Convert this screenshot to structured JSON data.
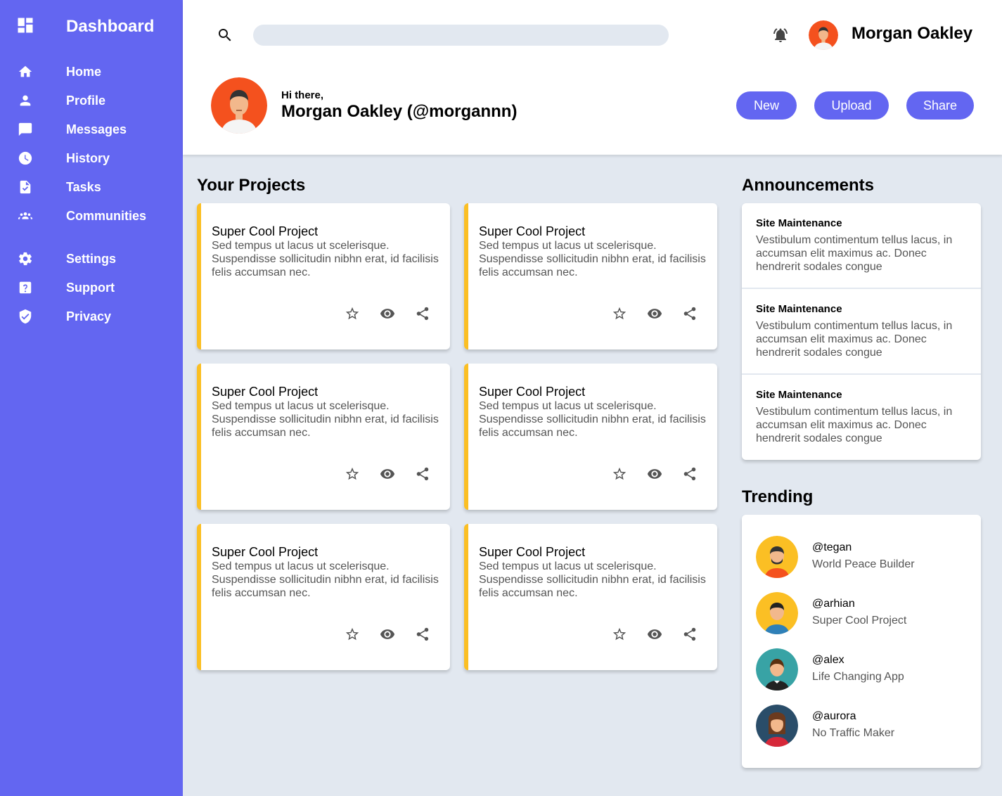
{
  "sidebar": {
    "brand": {
      "title": "Dashboard",
      "icon": "dashboard-icon"
    },
    "items": [
      {
        "label": "Home",
        "icon": "home-icon"
      },
      {
        "label": "Profile",
        "icon": "person-icon"
      },
      {
        "label": "Messages",
        "icon": "chat-icon"
      },
      {
        "label": "History",
        "icon": "clock-icon"
      },
      {
        "label": "Tasks",
        "icon": "task-icon"
      },
      {
        "label": "Communities",
        "icon": "group-icon"
      },
      {
        "label": "Settings",
        "icon": "gear-icon"
      },
      {
        "label": "Support",
        "icon": "help-icon"
      },
      {
        "label": "Privacy",
        "icon": "shield-icon"
      }
    ]
  },
  "header": {
    "search": {
      "placeholder": ""
    },
    "user_name": "Morgan Oakley",
    "greeting": "Hi there,",
    "full_name": "Morgan Oakley (@morgannn)",
    "buttons": {
      "new": "New",
      "upload": "Upload",
      "share": "Share"
    }
  },
  "projects": {
    "title": "Your Projects",
    "items": [
      {
        "title": "Super Cool Project",
        "description": "Sed tempus ut lacus ut scelerisque. Suspendisse sollicitudin nibhn erat, id facilisis felis accumsan nec."
      },
      {
        "title": "Super Cool Project",
        "description": "Sed tempus ut lacus ut scelerisque. Suspendisse sollicitudin nibhn erat, id facilisis felis accumsan nec."
      },
      {
        "title": "Super Cool Project",
        "description": "Sed tempus ut lacus ut scelerisque. Suspendisse sollicitudin nibhn erat, id facilisis felis accumsan nec."
      },
      {
        "title": "Super Cool Project",
        "description": "Sed tempus ut lacus ut scelerisque. Suspendisse sollicitudin nibhn erat, id facilisis felis accumsan nec."
      },
      {
        "title": "Super Cool Project",
        "description": "Sed tempus ut lacus ut scelerisque. Suspendisse sollicitudin nibhn erat, id facilisis felis accumsan nec."
      },
      {
        "title": "Super Cool Project",
        "description": "Sed tempus ut lacus ut scelerisque. Suspendisse sollicitudin nibhn erat, id facilisis felis accumsan nec."
      }
    ]
  },
  "announcements": {
    "title": "Announcements",
    "items": [
      {
        "title": "Site Maintenance",
        "body": "Vestibulum contimentum tellus lacus, in accumsan elit maximus ac. Donec hendrerit sodales congue"
      },
      {
        "title": "Site Maintenance",
        "body": "Vestibulum contimentum tellus lacus, in accumsan elit maximus ac. Donec hendrerit sodales congue"
      },
      {
        "title": "Site Maintenance",
        "body": "Vestibulum contimentum tellus lacus, in accumsan elit maximus ac. Donec hendrerit sodales congue"
      }
    ]
  },
  "trending": {
    "title": "Trending",
    "items": [
      {
        "handle": "@tegan",
        "desc": "World Peace Builder",
        "color": "#fbbf24"
      },
      {
        "handle": "@arhian",
        "desc": "Super Cool Project",
        "color": "#fbbf24"
      },
      {
        "handle": "@alex",
        "desc": "Life Changing App",
        "color": "#38a3a5"
      },
      {
        "handle": "@aurora",
        "desc": "No Traffic Maker",
        "color": "#2a4d69"
      }
    ]
  },
  "colors": {
    "accent": "#6366f1",
    "card_border": "#fbbf24",
    "background": "#e2e8f0"
  }
}
